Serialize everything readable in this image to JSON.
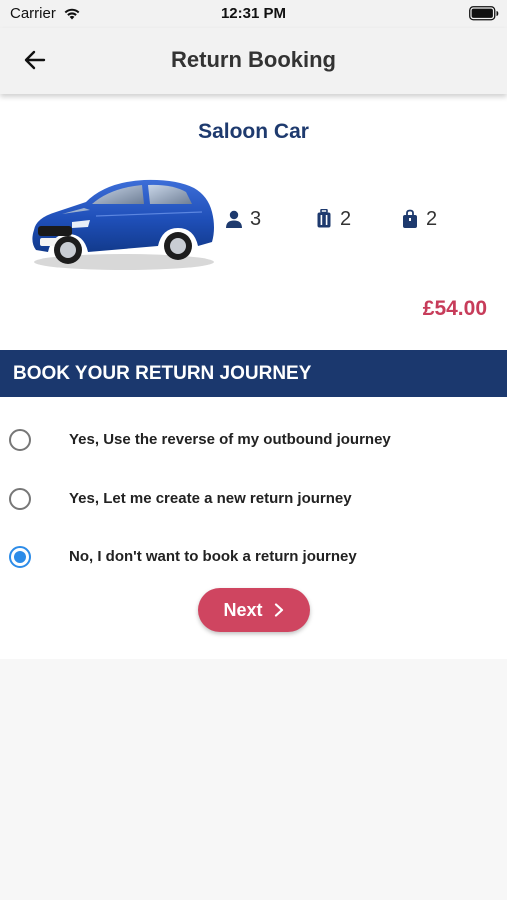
{
  "status_bar": {
    "carrier": "Carrier",
    "time": "12:31 PM",
    "icons": [
      "wifi-icon",
      "battery-icon"
    ]
  },
  "header": {
    "title": "Return Booking",
    "back_icon": "arrow-left-icon"
  },
  "vehicle": {
    "name": "Saloon Car",
    "image": "blue-saloon-car",
    "passengers": "3",
    "luggage": "2",
    "hand_bags": "2",
    "price": "£54.00"
  },
  "return_section": {
    "title": "BOOK YOUR RETURN JOURNEY",
    "options": [
      {
        "label": "Yes, Use the reverse of my outbound journey",
        "selected": false
      },
      {
        "label": "Yes, Let me create a new return journey",
        "selected": false
      },
      {
        "label": "No, I don't want to book a return journey",
        "selected": true
      }
    ],
    "next_label": "Next"
  },
  "colors": {
    "primary_navy": "#1b386e",
    "title_navy": "#1e3a6e",
    "accent_red": "#cf4560",
    "price_red": "#c73c5a",
    "radio_blue": "#2d8ce8"
  }
}
